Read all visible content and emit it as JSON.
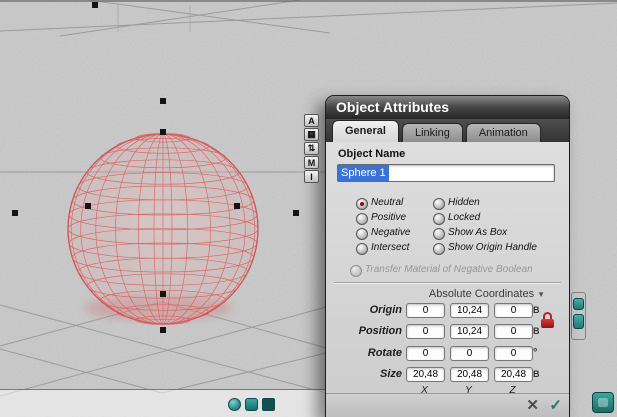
{
  "tray_toolbar": {
    "buttons": [
      "A",
      "▦",
      "⇅",
      "M",
      "I"
    ]
  },
  "dialog": {
    "title": "Object Attributes",
    "tabs": [
      {
        "label": "General",
        "active": true
      },
      {
        "label": "Linking",
        "active": false
      },
      {
        "label": "Animation",
        "active": false
      }
    ],
    "object_name": {
      "label": "Object Name",
      "value": "Sphere 1"
    },
    "options_left": [
      "Neutral",
      "Positive",
      "Negative",
      "Intersect"
    ],
    "options_left_selected": "Neutral",
    "options_right": [
      "Hidden",
      "Locked",
      "Show As Box",
      "Show Origin Handle"
    ],
    "transfer_option": "Transfer Material of Negative Boolean",
    "coordinates": {
      "mode": "Absolute Coordinates",
      "rows": [
        {
          "label": "Origin",
          "x": "0",
          "y": "10,24",
          "z": "0",
          "unit": "B"
        },
        {
          "label": "Position",
          "x": "0",
          "y": "10,24",
          "z": "0",
          "unit": "B"
        },
        {
          "label": "Rotate",
          "x": "0",
          "y": "0",
          "z": "0",
          "unit": "°"
        },
        {
          "label": "Size",
          "x": "20,48",
          "y": "20,48",
          "z": "20,48",
          "unit": "B"
        }
      ],
      "axes": [
        "X",
        "Y",
        "Z"
      ]
    },
    "footer": {
      "cancel": "✕",
      "confirm": "✓"
    }
  },
  "icons": {
    "dropdown_arrow": "▼"
  },
  "colors": {
    "wireframe": "#d96060",
    "selection_highlight": "#3b72d8",
    "lock_red": "#b32222",
    "accent_teal": "#2e8f8f"
  }
}
